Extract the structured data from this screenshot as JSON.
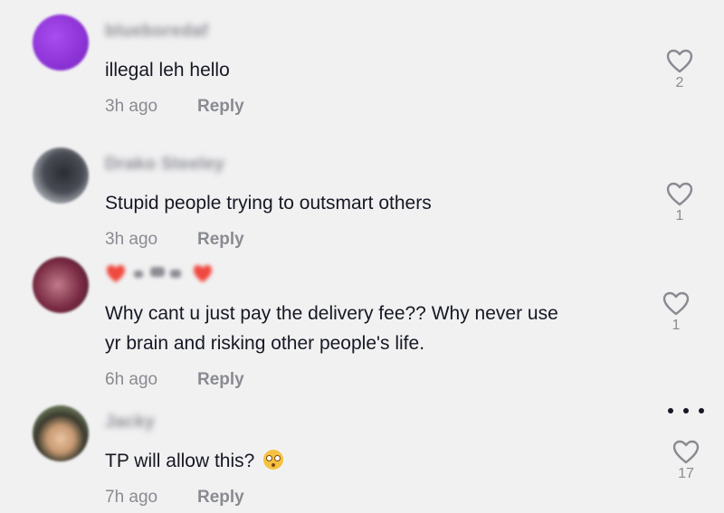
{
  "comments": [
    {
      "username": "blueboredaf",
      "text_lines": [
        "illegal leh hello"
      ],
      "time": "3h ago",
      "reply": "Reply",
      "likes": "2",
      "avatar_color": "#8b2bd6"
    },
    {
      "username": "Drako Steeley",
      "text_lines": [
        "Stupid people trying to outsmart others"
      ],
      "time": "3h ago",
      "reply": "Reply",
      "likes": "1",
      "avatar_color": "#3a3d45"
    },
    {
      "username": "",
      "text_lines": [
        "Why cant u just pay the delivery fee?? Why never use",
        "yr brain and risking other people's life."
      ],
      "time": "6h ago",
      "reply": "Reply",
      "likes": "1",
      "avatar_color": "#8a3a55"
    },
    {
      "username": "Jacky",
      "text_lines": [
        "TP will allow this?"
      ],
      "time": "7h ago",
      "reply": "Reply",
      "likes": "17",
      "avatar_color": "#5a6b52",
      "trailing_emoji": "flushed-face"
    }
  ],
  "icons": {
    "like": "heart-outline-icon",
    "more": "more-dots-icon"
  },
  "colors": {
    "background": "#f1f1f2",
    "text": "#161823",
    "secondary": "#8a8b91"
  }
}
